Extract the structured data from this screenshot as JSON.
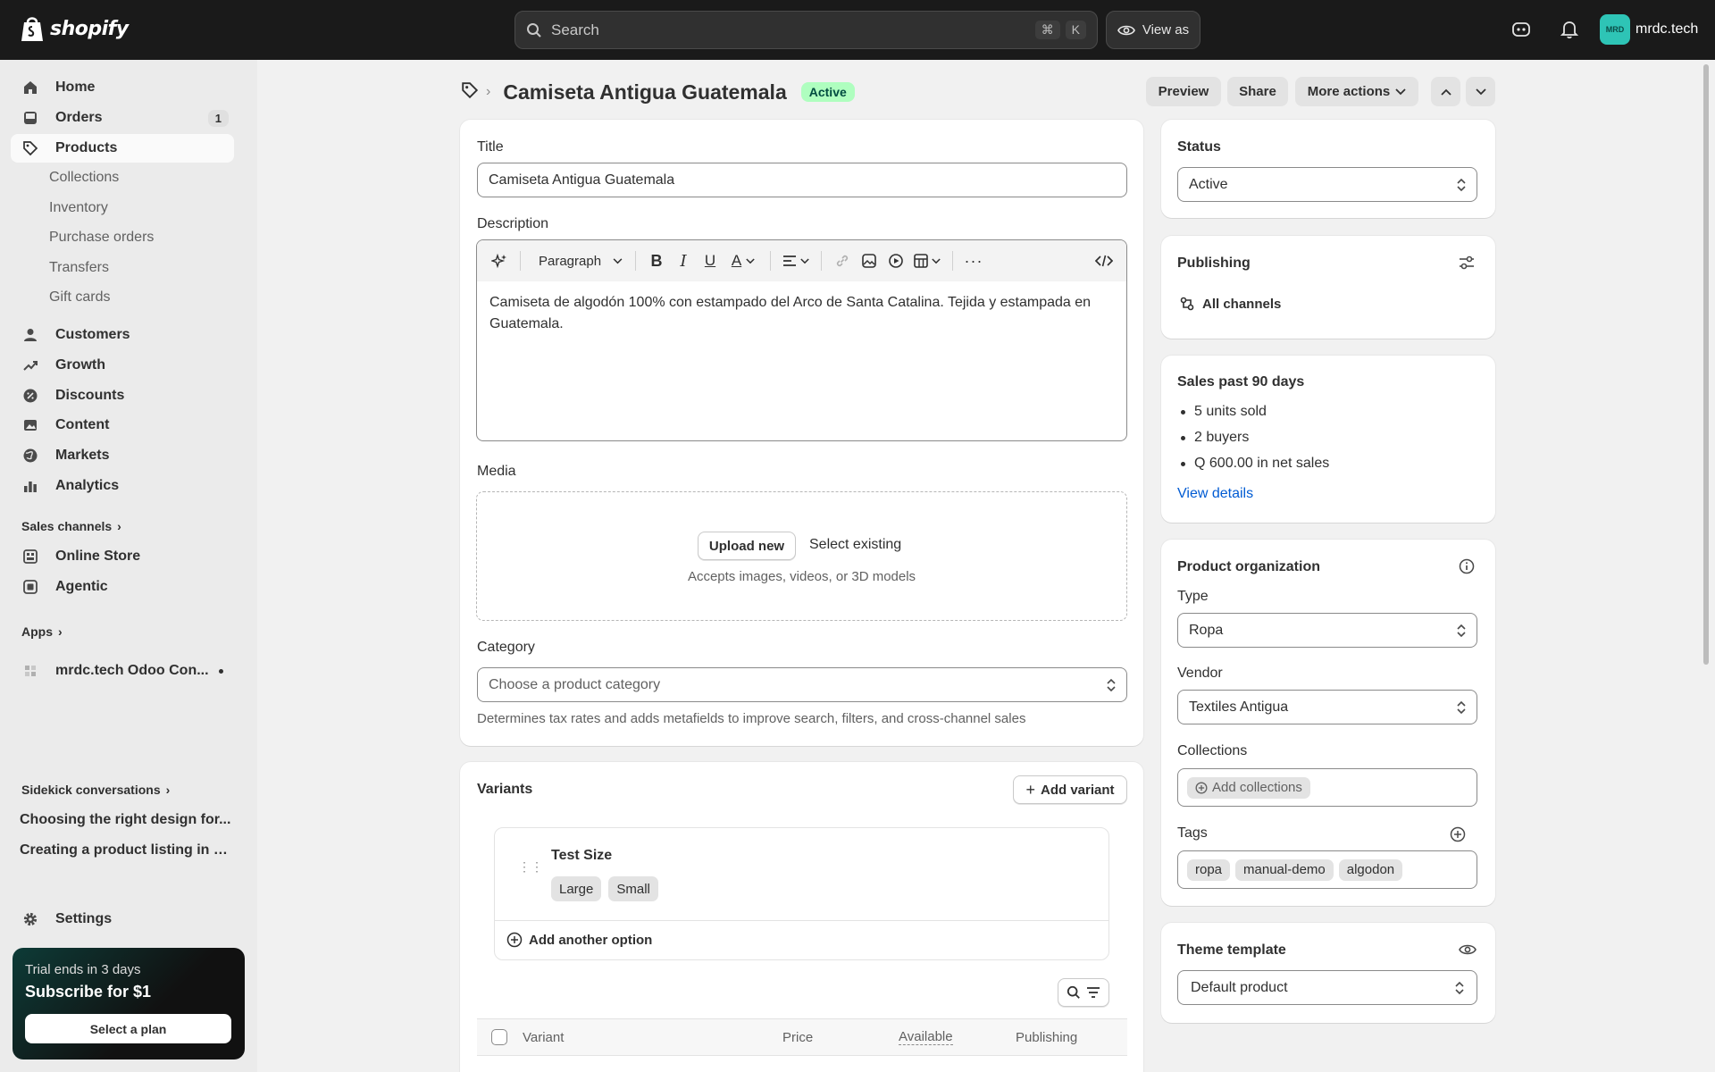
{
  "topbar": {
    "logo_text": "shopify",
    "search_placeholder": "Search",
    "shortcut_keys": [
      "⌘",
      "K"
    ],
    "view_as_label": "View as",
    "account_initials": "MRD",
    "account_name": "mrdc.tech",
    "avatar_color": "#2ec4b6"
  },
  "sidebar": {
    "nav": [
      {
        "label": "Home",
        "icon": "home-icon"
      },
      {
        "label": "Orders",
        "icon": "inbox-icon",
        "badge": "1"
      },
      {
        "label": "Products",
        "icon": "tag-icon"
      }
    ],
    "product_subnav": [
      "Collections",
      "Inventory",
      "Purchase orders",
      "Transfers",
      "Gift cards"
    ],
    "nav2": [
      {
        "label": "Customers",
        "icon": "person-icon"
      },
      {
        "label": "Growth",
        "icon": "growth-icon"
      },
      {
        "label": "Discounts",
        "icon": "discount-icon"
      },
      {
        "label": "Content",
        "icon": "content-icon"
      },
      {
        "label": "Markets",
        "icon": "globe-icon"
      },
      {
        "label": "Analytics",
        "icon": "chart-icon"
      }
    ],
    "sales_channels_label": "Sales channels",
    "channels": [
      {
        "label": "Online Store",
        "icon": "store-icon"
      },
      {
        "label": "Agentic",
        "icon": "agentic-icon"
      }
    ],
    "apps_label": "Apps",
    "app_item": "mrdc.tech Odoo Con...",
    "sidekick_label": "Sidekick conversations",
    "sidekick_items": [
      "Choosing the right design for...",
      "Creating a product listing in S..."
    ],
    "settings_label": "Settings",
    "trial": {
      "line1": "Trial ends in 3 days",
      "line2": "Subscribe for $1",
      "button": "Select a plan"
    }
  },
  "header": {
    "title": "Camiseta Antigua Guatemala",
    "status": "Active",
    "preview": "Preview",
    "share": "Share",
    "more_actions": "More actions"
  },
  "main": {
    "title_label": "Title",
    "title_value": "Camiseta Antigua Guatemala",
    "description_label": "Description",
    "paragraph_select": "Paragraph",
    "description_text": "Camiseta de algodón 100% con estampado del Arco de Santa Catalina. Tejida y estampada en Guatemala.",
    "media_label": "Media",
    "upload_new": "Upload new",
    "select_existing": "Select existing",
    "media_hint": "Accepts images, videos, or 3D models",
    "category_label": "Category",
    "category_placeholder": "Choose a product category",
    "category_hint": "Determines tax rates and adds metafields to improve search, filters, and cross-channel sales"
  },
  "variants": {
    "title": "Variants",
    "add_variant": "Add variant",
    "option_name": "Test Size",
    "option_values": [
      "Large",
      "Small"
    ],
    "add_option": "Add another option",
    "columns": [
      "Variant",
      "Price",
      "Available",
      "Publishing"
    ]
  },
  "right": {
    "status_label": "Status",
    "status_value": "Active",
    "publishing_label": "Publishing",
    "all_channels": "All channels",
    "sales_title": "Sales past 90 days",
    "sales_items": [
      "5 units sold",
      "2 buyers",
      "Q 600.00 in net sales"
    ],
    "view_details": "View details",
    "org_title": "Product organization",
    "type_label": "Type",
    "type_value": "Ropa",
    "vendor_label": "Vendor",
    "vendor_value": "Textiles Antigua",
    "collections_label": "Collections",
    "add_collections": "Add collections",
    "tags_label": "Tags",
    "tags": [
      "ropa",
      "manual-demo",
      "algodon"
    ],
    "theme_label": "Theme template",
    "theme_value": "Default product"
  },
  "colors": {
    "active_pill_bg": "#affebf",
    "active_pill_text": "#014b40",
    "link": "#005bd3",
    "topbar": "#1a1a1a"
  }
}
